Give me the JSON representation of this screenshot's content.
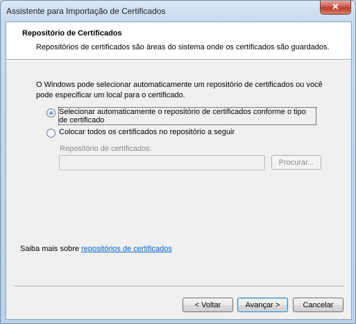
{
  "window": {
    "title": "Assistente para Importação de Certificados",
    "close_glyph": "✕"
  },
  "header": {
    "title": "Repositório de Certificados",
    "description": "Repositórios de certificados são áreas do sistema onde os certificados são guardados."
  },
  "intro": "O Windows pode selecionar automaticamente um repositório de certificados ou você pode especificar um local para o certificado.",
  "options": [
    {
      "label": "Selecionar automaticamente o repositório de certificados conforme o tipo de certificado",
      "selected": true
    },
    {
      "label": "Colocar todos os certificados no repositório a seguir",
      "selected": false
    }
  ],
  "store": {
    "label": "Repositório de certificados:",
    "value": "",
    "browse_label": "Procurar..."
  },
  "learn_more": {
    "prefix": "Saiba mais sobre ",
    "link": "repositórios de certificados"
  },
  "buttons": {
    "back": "< Voltar",
    "next": "Avançar >",
    "cancel": "Cancelar"
  }
}
